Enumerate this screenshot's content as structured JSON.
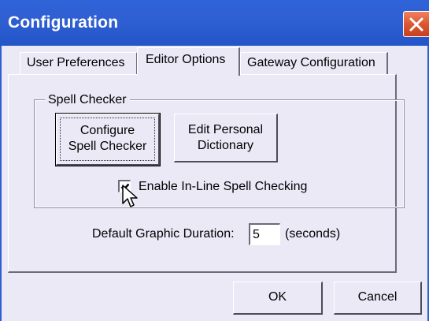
{
  "window": {
    "title": "Configuration",
    "close_icon": "close-icon",
    "accent_color": "#2f5fd2",
    "close_color": "#d9532e"
  },
  "tabs": [
    {
      "label": "User Preferences",
      "active": false
    },
    {
      "label": "Editor Options",
      "active": true
    },
    {
      "label": "Gateway Configuration",
      "active": false
    }
  ],
  "spell_checker": {
    "group_label": "Spell Checker",
    "configure_button": [
      "Configure",
      "Spell Checker"
    ],
    "edit_dictionary_button": [
      "Edit Personal",
      "Dictionary"
    ],
    "inline_checkbox": {
      "label": "Enable In-Line Spell Checking",
      "checked": true
    }
  },
  "graphic_duration": {
    "label": "Default Graphic Duration:",
    "value": "5",
    "unit_label": "(seconds)"
  },
  "footer": {
    "ok_label": "OK",
    "cancel_label": "Cancel"
  },
  "cursor_icon": "mouse-pointer-icon"
}
